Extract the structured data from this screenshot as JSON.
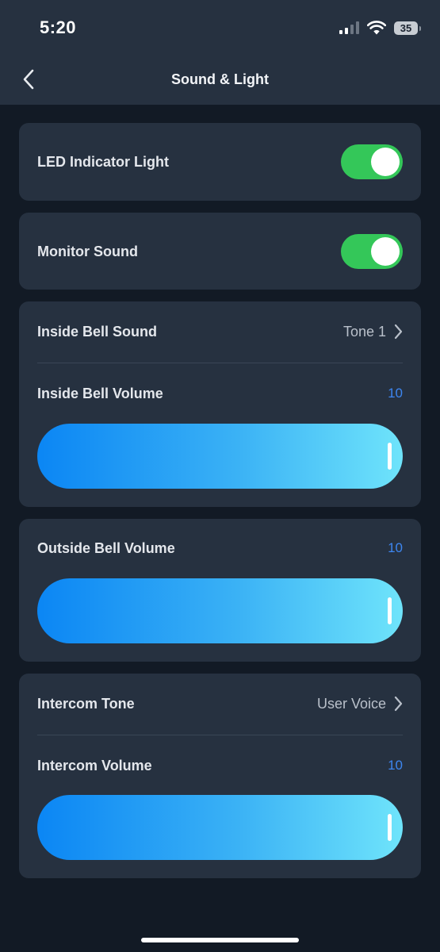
{
  "status_bar": {
    "time": "5:20",
    "battery": "35",
    "signal_bars_active": 2,
    "signal_bars_total": 4
  },
  "header": {
    "title": "Sound & Light",
    "back_icon": "chevron-left-icon"
  },
  "settings": {
    "led_indicator": {
      "label": "LED Indicator Light",
      "enabled": true
    },
    "monitor_sound": {
      "label": "Monitor Sound",
      "enabled": true
    },
    "inside_bell_sound": {
      "label": "Inside Bell Sound",
      "value": "Tone 1"
    },
    "inside_bell_volume": {
      "label": "Inside Bell Volume",
      "value": "10",
      "level": 1.0
    },
    "outside_bell_volume": {
      "label": "Outside Bell Volume",
      "value": "10",
      "level": 1.0
    },
    "intercom_tone": {
      "label": "Intercom Tone",
      "value": "User Voice"
    },
    "intercom_volume": {
      "label": "Intercom Volume",
      "value": "10",
      "level": 1.0
    }
  },
  "colors": {
    "toggle_on": "#34c759",
    "volume_value": "#3d86f0",
    "slider_start": "#0b86f4",
    "slider_end": "#6fe4fb",
    "card_background": "#263140",
    "page_background": "#121a25"
  }
}
